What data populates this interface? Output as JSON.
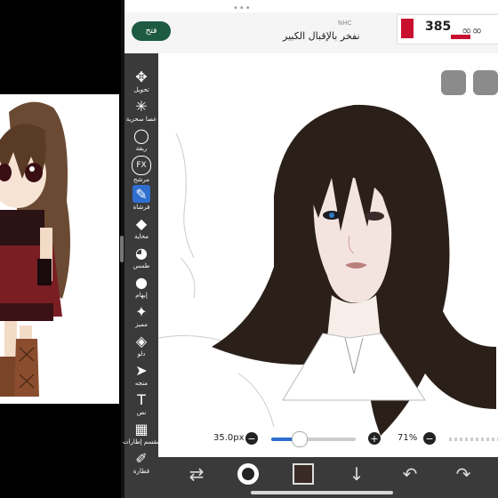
{
  "ad": {
    "open_label": "فتح",
    "brand": "NHC",
    "text": "نفخر بالإقبال الكبير",
    "price": "385"
  },
  "tools": [
    {
      "name": "transform",
      "label": "تحويل",
      "icon": "move-icon"
    },
    {
      "name": "magic-wand",
      "label": "عصا سحرية",
      "icon": "wand-icon"
    },
    {
      "name": "lasso",
      "label": "ربقة",
      "icon": "lasso-icon"
    },
    {
      "name": "filter",
      "label": "مرشح",
      "icon": "fx-icon",
      "icon_text": "FX"
    },
    {
      "name": "brush",
      "label": "فرشاة",
      "icon": "brush-icon",
      "active": true
    },
    {
      "name": "eraser",
      "label": "محاية",
      "icon": "eraser-icon"
    },
    {
      "name": "smudge",
      "label": "طمس",
      "icon": "smudge-icon"
    },
    {
      "name": "blur",
      "label": "إبهام",
      "icon": "drop-icon"
    },
    {
      "name": "special",
      "label": "مميز",
      "icon": "sparkle-icon"
    },
    {
      "name": "fill",
      "label": "دلو",
      "icon": "bucket-icon"
    },
    {
      "name": "select",
      "label": "منجه",
      "icon": "cursor-icon"
    },
    {
      "name": "text",
      "label": "نص",
      "icon": "text-icon",
      "icon_text": "T"
    },
    {
      "name": "frame-divider",
      "label": "مقسم إطارات",
      "icon": "frame-icon"
    },
    {
      "name": "eyedropper",
      "label": "قطارة",
      "icon": "eyedropper-icon"
    }
  ],
  "canvas": {
    "brush_size": "35.0px",
    "opacity": "71%",
    "minus_symbol": "−",
    "plus_symbol": "+"
  },
  "bottom_bar": {
    "icons": [
      "transform-icon",
      "color-circle-icon",
      "color-swatch-icon",
      "download-icon",
      "undo-icon",
      "redo-icon"
    ]
  }
}
